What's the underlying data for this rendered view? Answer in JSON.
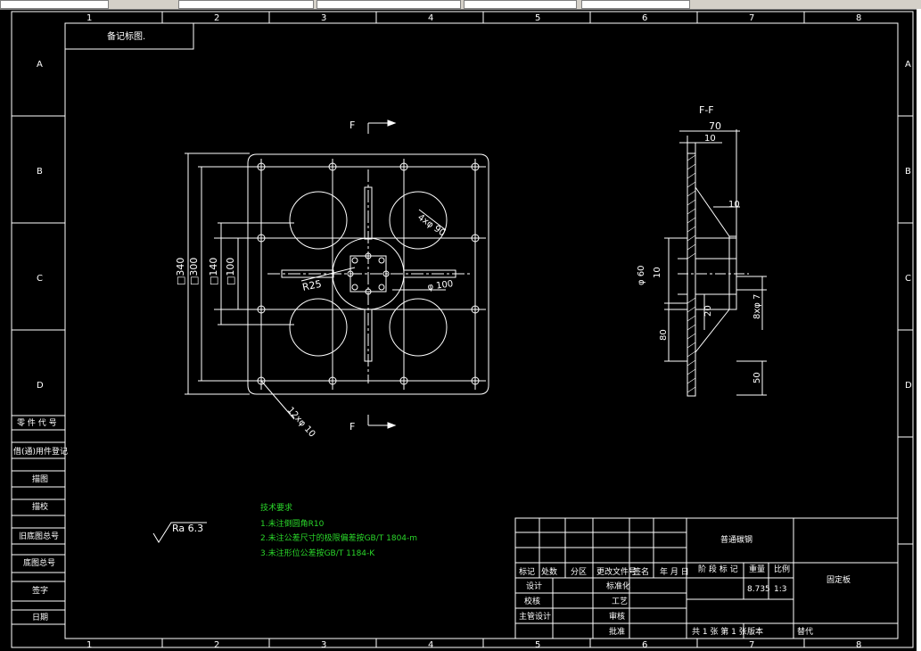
{
  "colors": {
    "background": "#000000",
    "lines": "#ffffff",
    "notes": "#2ad62a",
    "toolbar": "#d4d0c8"
  },
  "drawing": {
    "sheet_cols_top": [
      "1",
      "2",
      "3",
      "4",
      "5",
      "6",
      "7",
      "8"
    ],
    "sheet_cols_bottom": [
      "1",
      "2",
      "3",
      "4",
      "5",
      "6",
      "7",
      "8"
    ],
    "sheet_rows_left": [
      "A",
      "B",
      "C",
      "D"
    ],
    "sheet_rows_right": [
      "A",
      "B",
      "C",
      "D"
    ],
    "corner_label": "备记标图.",
    "section_mark_top": "F",
    "section_mark_bottom": "F",
    "section_title": "F-F",
    "dim_340": "□340",
    "dim_300": "□300",
    "dim_140": "□140",
    "dim_100": "□100",
    "dim_r25": "R25",
    "dim_d90": "4xφ 90",
    "dim_d100": "φ 100",
    "dim_holes": "12xφ 10",
    "dim_70": "70",
    "dim_10a": "10",
    "dim_10b": "10",
    "dim_d60": "φ 60",
    "dim_10c": "10",
    "dim_20": "20",
    "dim_8d7": "8xφ 7",
    "dim_80": "80",
    "dim_50": "50",
    "roughness": "Ra 6.3",
    "notes_title": "技术要求",
    "notes": [
      "1.未注倒圆角R10",
      "2.未注公差尺寸的极限偏差按GB/T 1804-m",
      "3.未注形位公差按GB/T 1184-K"
    ],
    "left_strip": [
      "零 件 代 号",
      "借(通)用件登记",
      "描图",
      "描校",
      "旧底图总号",
      "底图总号",
      "签字",
      "日期"
    ],
    "title_block": {
      "material": "普通碳钢",
      "part_name": "固定板",
      "headers": [
        "标记",
        "处数",
        "分区",
        "更改文件号",
        "签名",
        "年 月 日"
      ],
      "stage": "阶 段 标 记",
      "weight_label": "重量",
      "scale_label": "比例",
      "weight": "8.735",
      "scale": "1:3",
      "design": "设计",
      "standardize": "标准化",
      "check": "校核",
      "process": "工艺",
      "chief": "主管设计",
      "review": "审核",
      "approve": "批准",
      "sheets": "共 1 张  第 1 张",
      "version": "版本",
      "replace": "替代"
    }
  }
}
